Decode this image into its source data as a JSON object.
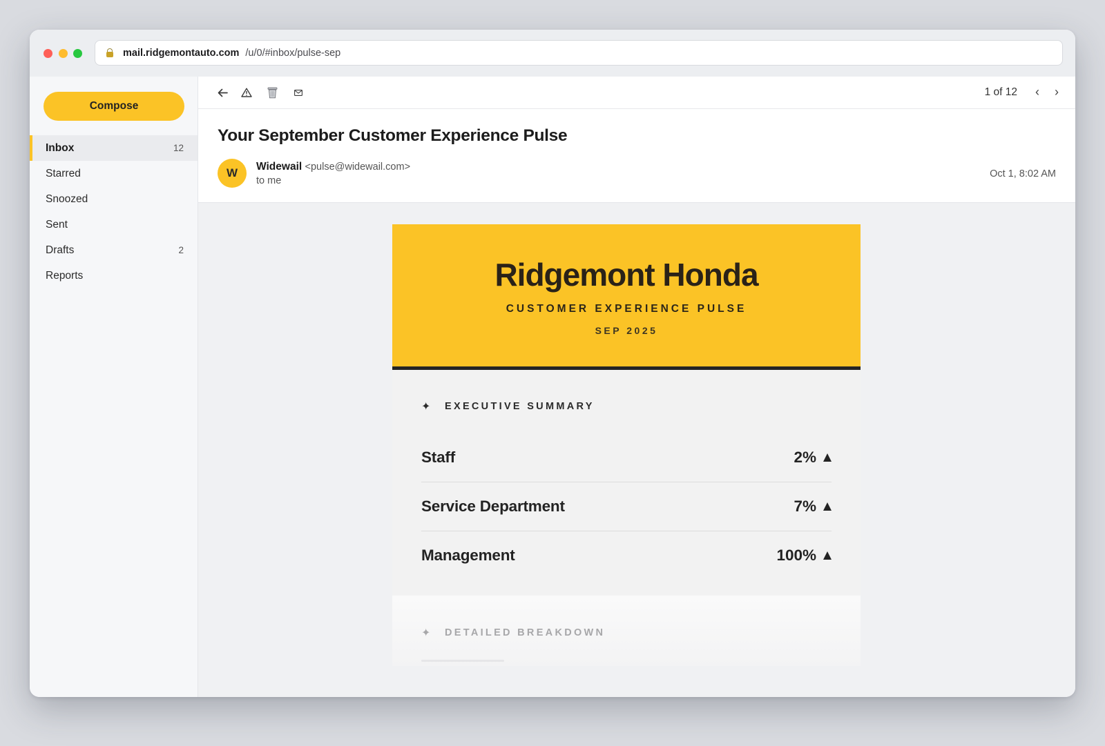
{
  "browser": {
    "domain": "mail.ridgemontauto.com",
    "path": "/u/0/#inbox/pulse-sep"
  },
  "sidebar": {
    "compose_label": "Compose",
    "items": [
      {
        "label": "Inbox",
        "count": "12",
        "active": true
      },
      {
        "label": "Starred",
        "count": ""
      },
      {
        "label": "Snoozed",
        "count": ""
      },
      {
        "label": "Sent",
        "count": ""
      },
      {
        "label": "Drafts",
        "count": "2"
      },
      {
        "label": "Reports",
        "count": ""
      }
    ]
  },
  "toolbar": {
    "icons": [
      "back-arrow-icon",
      "report-spam-icon",
      "delete-icon",
      "mark-unread-icon"
    ],
    "pager": "1 of 12"
  },
  "message": {
    "subject": "Your September Customer Experience Pulse",
    "avatar_letter": "W",
    "sender_name": "Widewail",
    "sender_email": "<pulse@widewail.com>",
    "to": "to me",
    "date": "Oct 1, 8:02 AM"
  },
  "email": {
    "brand": "Ridgemont Honda",
    "subtitle": "CUSTOMER EXPERIENCE PULSE",
    "period": "SEP 2025",
    "summary_title": "EXECUTIVE SUMMARY",
    "summary_rows": [
      {
        "label": "Staff",
        "value": "2%",
        "trend": "up"
      },
      {
        "label": "Service Department",
        "value": "7%",
        "trend": "up"
      },
      {
        "label": "Management",
        "value": "100%",
        "trend": "up"
      }
    ],
    "breakdown_title": "DETAILED BREAKDOWN"
  },
  "colors": {
    "accent": "#fbc326",
    "dark": "#242424"
  }
}
